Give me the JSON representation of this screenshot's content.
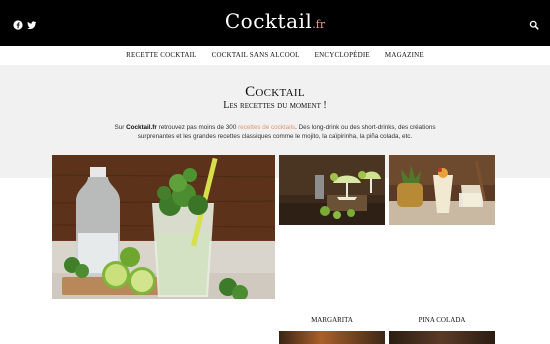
{
  "header": {
    "logo_main": "Cocktail",
    "logo_ext": ".fr",
    "icons": [
      "facebook-icon",
      "twitter-icon",
      "search-icon"
    ],
    "background_color": "#000000",
    "logo_accent_color": "#e2a07f"
  },
  "nav": {
    "items": [
      {
        "label": "RECETTE COCKTAIL"
      },
      {
        "label": "COCKTAIL SANS ALCOOL"
      },
      {
        "label": "ENCYCLOPÉDIE"
      },
      {
        "label": "MAGAZINE"
      }
    ]
  },
  "hero": {
    "title": "Cocktail",
    "subtitle": "Les recettes du moment !",
    "intro_prefix": "Sur ",
    "intro_site": "Cocktail.fr",
    "intro_middle": " retrouvez pas moins de 300 ",
    "intro_link": "recettes de cocktails",
    "intro_suffix": ". Des long-drink ou des short-drinks, des créations surprenantes et les grandes recettes classiques comme le mojito, la caïpirinha, la piña colada, etc.",
    "background_color": "#f1f1f1",
    "link_color": "#e0946e"
  },
  "photos": [
    {
      "caption": ""
    },
    {
      "caption": "MARGARITA"
    },
    {
      "caption": "PINA COLADA"
    }
  ]
}
